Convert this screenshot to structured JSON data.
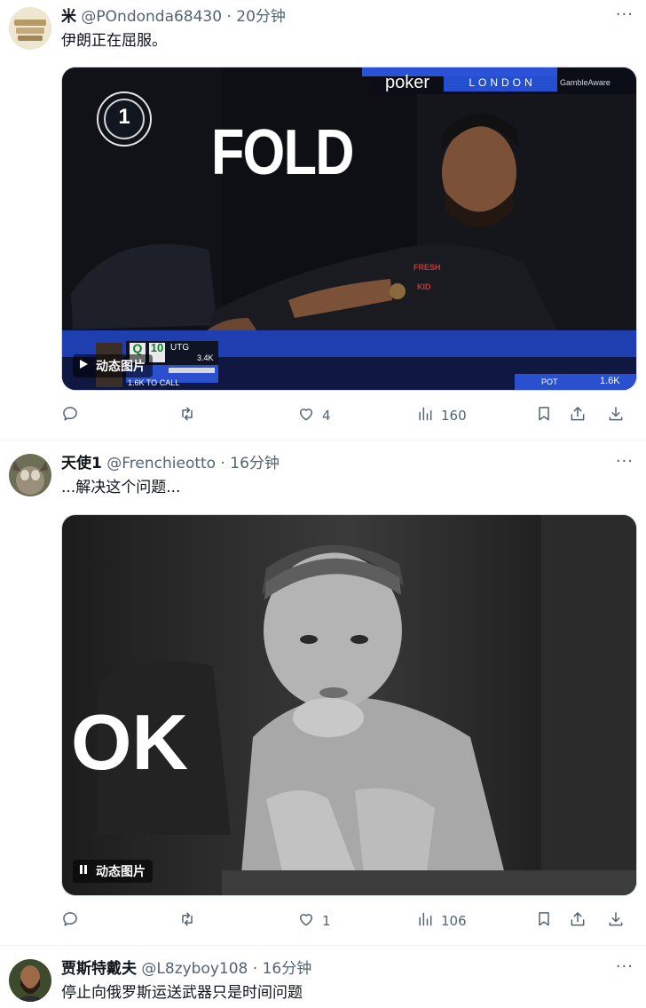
{
  "tweets": [
    {
      "name": "米",
      "handle": "@POndonda68430",
      "time": "20分钟",
      "text": "伊朗正在屈服。",
      "gif_label": "动态图片",
      "overlay": {
        "headline": "FOLD",
        "brand": "poker",
        "city": "LONDON",
        "sponsor": "GambleAware",
        "emblem_number": "1",
        "card_left": "Q",
        "card_right": "10",
        "seat": "UTG",
        "stack": "3.4K",
        "to_call": "1.6K TO CALL",
        "pot_label": "POT",
        "pot_value": "1.6K",
        "shirt_text": "FRESH KID"
      },
      "likes": "4",
      "views": "160",
      "replies": "",
      "retweets": ""
    },
    {
      "name": "天使1",
      "handle": "@Frenchieotto",
      "time": "16分钟",
      "text": "...解决这个问题...",
      "gif_label": "动态图片",
      "overlay": {
        "headline": "OK"
      },
      "likes": "1",
      "views": "106",
      "replies": "",
      "retweets": ""
    },
    {
      "name": "贾斯特戴夫",
      "handle": "@L8zyboy108",
      "time": "16分钟",
      "text": "停止向俄罗斯运送武器只是时间问题"
    }
  ],
  "ui": {
    "separator": "·",
    "more": "···"
  },
  "icons": [
    "reply-icon",
    "retweet-icon",
    "like-icon",
    "views-icon",
    "bookmark-icon",
    "share-icon",
    "download-icon",
    "play-icon",
    "pause-icon",
    "more-icon"
  ],
  "colors": {
    "text": "#0f1419",
    "secondary": "#536471",
    "border": "#cfd9de",
    "divider": "#eff3f4",
    "poker_blue": "#1a3aa8"
  }
}
